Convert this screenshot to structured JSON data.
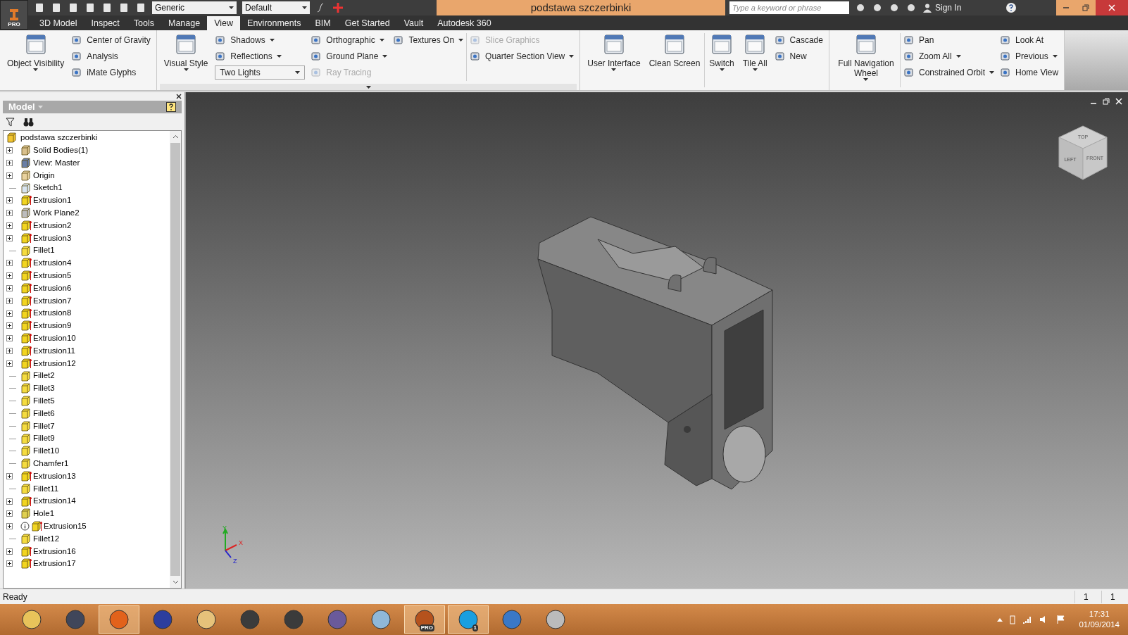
{
  "app_button": {
    "badge": "PRO"
  },
  "quick_access": {
    "style_combo": "Generic",
    "appearance_combo": "Default"
  },
  "window": {
    "title": "podstawa szczerbinki"
  },
  "help_search": {
    "placeholder": "Type a keyword or phrase",
    "sign_in": "Sign In"
  },
  "tabs": [
    {
      "label": "3D Model",
      "selected": false
    },
    {
      "label": "Inspect",
      "selected": false
    },
    {
      "label": "Tools",
      "selected": false
    },
    {
      "label": "Manage",
      "selected": false
    },
    {
      "label": "View",
      "selected": true
    },
    {
      "label": "Environments",
      "selected": false
    },
    {
      "label": "BIM",
      "selected": false
    },
    {
      "label": "Get Started",
      "selected": false
    },
    {
      "label": "Vault",
      "selected": false
    },
    {
      "label": "Autodesk 360",
      "selected": false
    }
  ],
  "ribbon": {
    "panels": [
      {
        "expander": false,
        "columns": [
          {
            "kind": "large",
            "label": "Object Visibility",
            "menu": true
          },
          {
            "kind": "stack",
            "items": [
              {
                "kind": "button",
                "label": "Center of Gravity",
                "menu": false,
                "disabled": false
              },
              {
                "kind": "button",
                "label": "Analysis",
                "menu": false,
                "disabled": false
              },
              {
                "kind": "button",
                "label": "iMate Glyphs",
                "menu": false,
                "disabled": false
              }
            ]
          }
        ]
      },
      {
        "expander": true,
        "columns": [
          {
            "kind": "large",
            "label": "Visual Style",
            "menu": true
          },
          {
            "kind": "stack",
            "items": [
              {
                "kind": "button",
                "label": "Shadows",
                "menu": true,
                "disabled": false
              },
              {
                "kind": "button",
                "label": "Reflections",
                "menu": true,
                "disabled": false
              },
              {
                "kind": "combo",
                "label": "Two Lights",
                "menu": true
              }
            ]
          },
          {
            "kind": "stack",
            "items": [
              {
                "kind": "button",
                "label": "Orthographic",
                "menu": true,
                "disabled": false
              },
              {
                "kind": "button",
                "label": "Ground Plane",
                "menu": true,
                "disabled": false
              },
              {
                "kind": "button",
                "label": "Ray Tracing",
                "menu": false,
                "disabled": true
              }
            ]
          },
          {
            "kind": "stack",
            "items": [
              {
                "kind": "button",
                "label": "Textures On",
                "menu": true,
                "disabled": false
              }
            ]
          },
          {
            "kind": "separator"
          },
          {
            "kind": "stack",
            "items": [
              {
                "kind": "button",
                "label": "Slice Graphics",
                "menu": false,
                "disabled": true
              },
              {
                "kind": "button",
                "label": "Quarter Section View",
                "menu": true,
                "disabled": false
              }
            ]
          }
        ]
      },
      {
        "expander": false,
        "columns": [
          {
            "kind": "large",
            "label": "User Interface",
            "menu": true
          },
          {
            "kind": "large",
            "label": "Clean Screen",
            "menu": false
          },
          {
            "kind": "separator"
          },
          {
            "kind": "large",
            "label": "Switch",
            "menu": true
          },
          {
            "kind": "large",
            "label": "Tile All",
            "menu": true
          },
          {
            "kind": "stack",
            "items": [
              {
                "kind": "button",
                "label": "Cascade",
                "menu": false,
                "disabled": false
              },
              {
                "kind": "button",
                "label": "New",
                "menu": false,
                "disabled": false
              }
            ]
          }
        ]
      },
      {
        "expander": false,
        "columns": [
          {
            "kind": "large",
            "label": "Full Navigation Wheel",
            "menu": true
          },
          {
            "kind": "separator"
          },
          {
            "kind": "stack",
            "items": [
              {
                "kind": "button",
                "label": "Pan",
                "menu": false,
                "disabled": false
              },
              {
                "kind": "button",
                "label": "Zoom All",
                "menu": true,
                "disabled": false
              },
              {
                "kind": "button",
                "label": "Constrained Orbit",
                "menu": true,
                "disabled": false
              }
            ]
          },
          {
            "kind": "stack",
            "items": [
              {
                "kind": "button",
                "label": "Look At",
                "menu": false,
                "disabled": false
              },
              {
                "kind": "button",
                "label": "Previous",
                "menu": true,
                "disabled": false
              },
              {
                "kind": "button",
                "label": "Home View",
                "menu": false,
                "disabled": false
              }
            ]
          }
        ]
      }
    ]
  },
  "browser": {
    "title": "Model",
    "tree": {
      "label": "podstawa szczerbinki",
      "kind": "part",
      "children": [
        {
          "label": "Solid Bodies(1)",
          "kind": "bodies",
          "expandable": true
        },
        {
          "label": "View: Master",
          "kind": "view",
          "expandable": true
        },
        {
          "label": "Origin",
          "kind": "folder",
          "expandable": true
        },
        {
          "label": "Sketch1",
          "kind": "sketch",
          "expandable": false
        },
        {
          "label": "Extrusion1",
          "kind": "extrusion",
          "expandable": true
        },
        {
          "label": "Work Plane2",
          "kind": "plane",
          "expandable": true
        },
        {
          "label": "Extrusion2",
          "kind": "extrusion",
          "expandable": true
        },
        {
          "label": "Extrusion3",
          "kind": "extrusion",
          "expandable": true
        },
        {
          "label": "Fillet1",
          "kind": "fillet",
          "expandable": false
        },
        {
          "label": "Extrusion4",
          "kind": "extrusion",
          "expandable": true
        },
        {
          "label": "Extrusion5",
          "kind": "extrusion",
          "expandable": true
        },
        {
          "label": "Extrusion6",
          "kind": "extrusion",
          "expandable": true
        },
        {
          "label": "Extrusion7",
          "kind": "extrusion",
          "expandable": true
        },
        {
          "label": "Extrusion8",
          "kind": "extrusion",
          "expandable": true
        },
        {
          "label": "Extrusion9",
          "kind": "extrusion",
          "expandable": true
        },
        {
          "label": "Extrusion10",
          "kind": "extrusion",
          "expandable": true
        },
        {
          "label": "Extrusion11",
          "kind": "extrusion",
          "expandable": true
        },
        {
          "label": "Extrusion12",
          "kind": "extrusion",
          "expandable": true
        },
        {
          "label": "Fillet2",
          "kind": "fillet",
          "expandable": false
        },
        {
          "label": "Fillet3",
          "kind": "fillet",
          "expandable": false
        },
        {
          "label": "Fillet5",
          "kind": "fillet",
          "expandable": false
        },
        {
          "label": "Fillet6",
          "kind": "fillet",
          "expandable": false
        },
        {
          "label": "Fillet7",
          "kind": "fillet",
          "expandable": false
        },
        {
          "label": "Fillet9",
          "kind": "fillet",
          "expandable": false
        },
        {
          "label": "Fillet10",
          "kind": "fillet",
          "expandable": false
        },
        {
          "label": "Chamfer1",
          "kind": "chamfer",
          "expandable": false
        },
        {
          "label": "Extrusion13",
          "kind": "extrusion",
          "expandable": true
        },
        {
          "label": "Fillet11",
          "kind": "fillet",
          "expandable": false
        },
        {
          "label": "Extrusion14",
          "kind": "extrusion",
          "expandable": true
        },
        {
          "label": "Hole1",
          "kind": "hole",
          "expandable": true
        },
        {
          "label": "Extrusion15",
          "kind": "extrusion_info",
          "expandable": true
        },
        {
          "label": "Fillet12",
          "kind": "fillet",
          "expandable": false
        },
        {
          "label": "Extrusion16",
          "kind": "extrusion",
          "expandable": true
        },
        {
          "label": "Extrusion17",
          "kind": "extrusion",
          "expandable": true
        }
      ]
    }
  },
  "viewport": {
    "view_cube": {
      "top": "TOP",
      "left": "LEFT",
      "front": "FRONT"
    },
    "axes": {
      "x": "X",
      "y": "Y",
      "z": "Z"
    }
  },
  "status_bar": {
    "message": "Ready",
    "count_1": "1",
    "count_2": "1"
  },
  "taskbar": {
    "apps": [
      {
        "kind": "folder",
        "selected": false
      },
      {
        "kind": "globe",
        "selected": false
      },
      {
        "kind": "browser",
        "selected": true
      },
      {
        "kind": "help",
        "selected": false
      },
      {
        "kind": "character",
        "selected": false
      },
      {
        "kind": "game",
        "selected": false
      },
      {
        "kind": "game",
        "selected": false
      },
      {
        "kind": "shield",
        "selected": false
      },
      {
        "kind": "paint",
        "selected": false
      },
      {
        "kind": "cad",
        "selected": true,
        "badge": "PRO"
      },
      {
        "kind": "chat",
        "selected": true,
        "badge": "1"
      },
      {
        "kind": "media",
        "selected": false
      },
      {
        "kind": "speaker",
        "selected": false
      }
    ],
    "time": "17:31",
    "date": "01/09/2014"
  }
}
